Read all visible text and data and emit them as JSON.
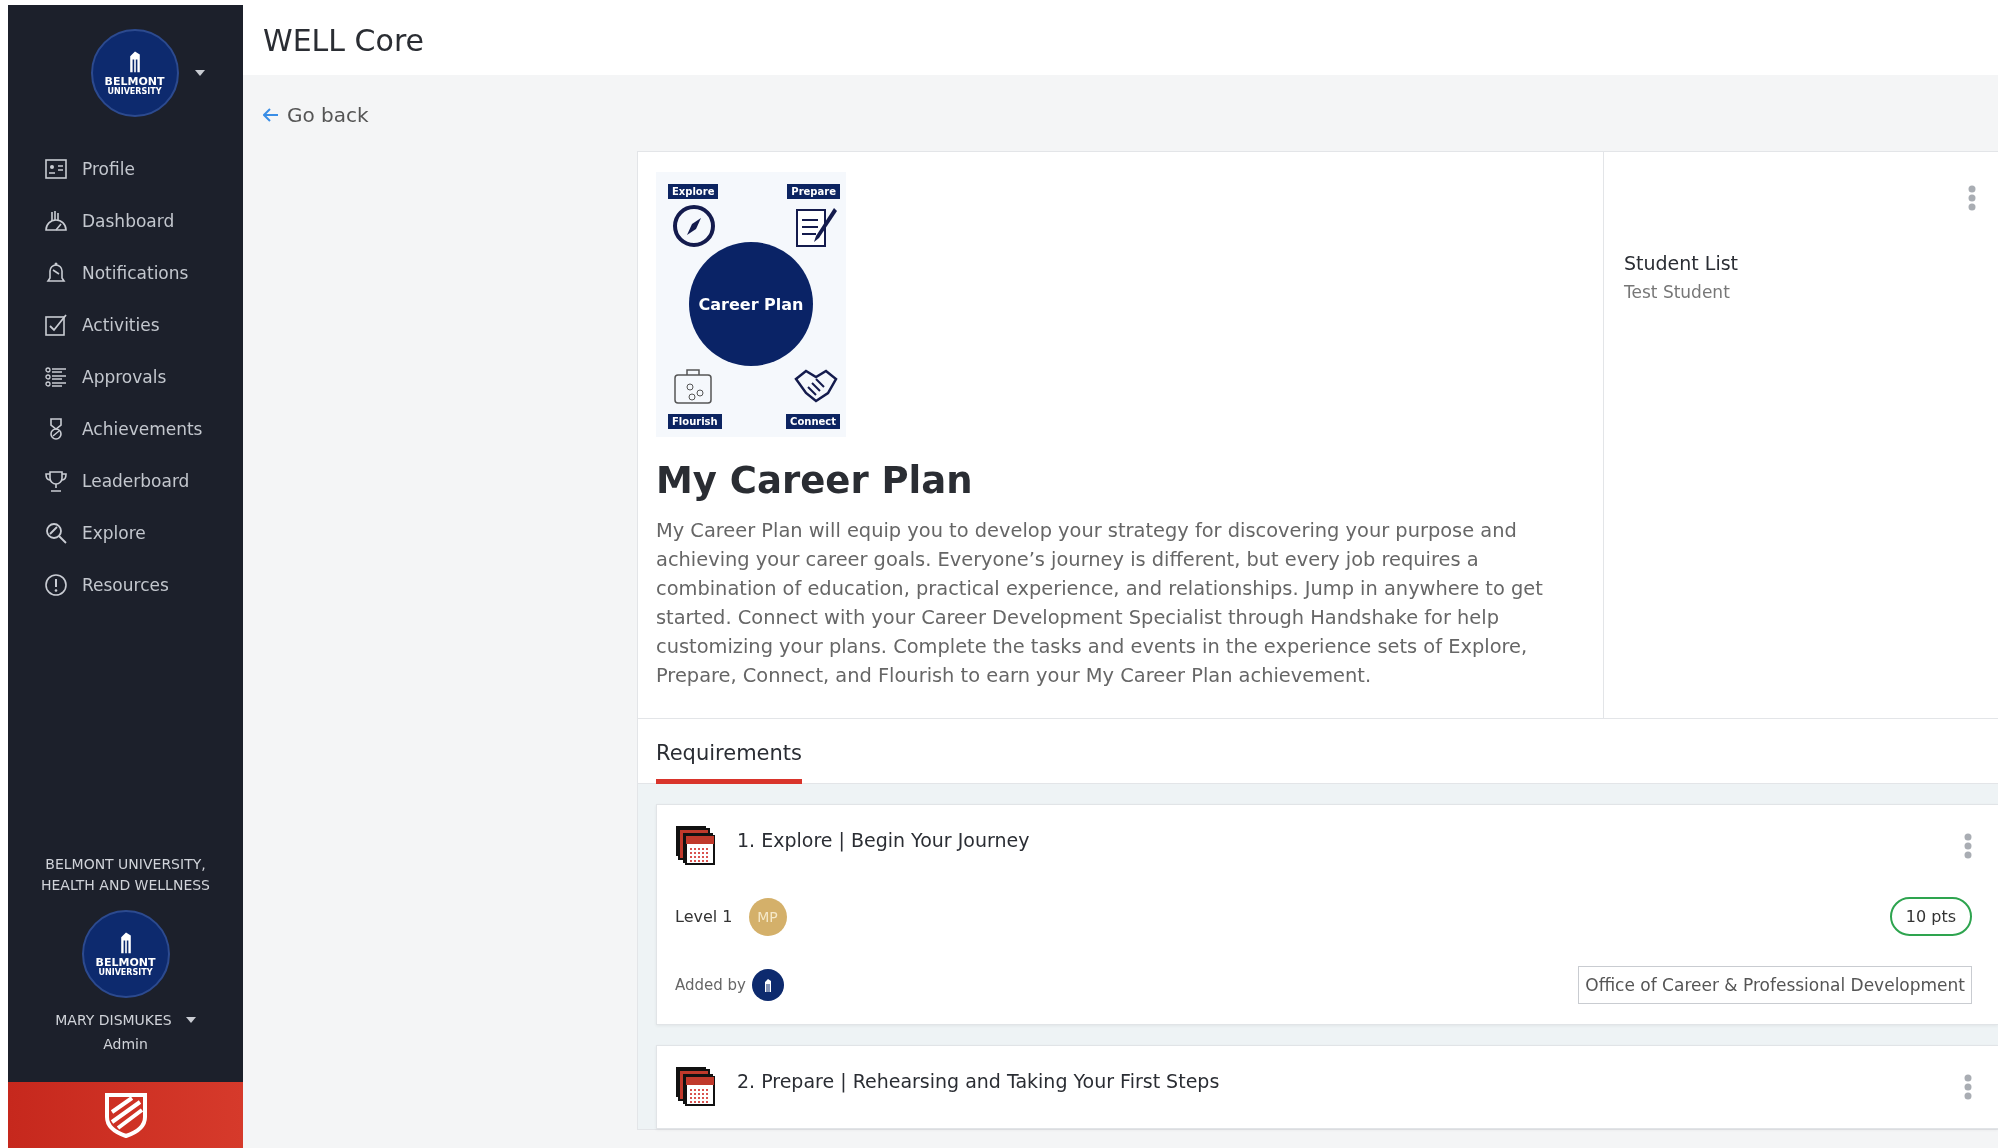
{
  "sidebar": {
    "logo": {
      "line1": "BELMONT",
      "line2": "UNIVERSITY"
    },
    "items": [
      {
        "label": "Profile",
        "selected": false
      },
      {
        "label": "Dashboard",
        "selected": false
      },
      {
        "label": "Notifications",
        "selected": false
      },
      {
        "label": "Activities",
        "selected": false
      },
      {
        "label": "Approvals",
        "selected": false
      },
      {
        "label": "Achievements",
        "selected": false
      },
      {
        "label": "Leaderboard",
        "selected": false
      },
      {
        "label": "Explore",
        "selected": false
      },
      {
        "label": "Resources",
        "selected": false
      }
    ],
    "org": "BELMONT UNIVERSITY, HEALTH AND WELLNESS",
    "user_logo": {
      "line1": "BELMONT",
      "line2": "UNIVERSITY"
    },
    "user_name": "MARY DISMUKES",
    "user_role": "Admin"
  },
  "header": {
    "title": "WELL Core"
  },
  "back_link": "Go back",
  "plan": {
    "image": {
      "center": "Career Plan",
      "labels": [
        "Explore",
        "Prepare",
        "Flourish",
        "Connect"
      ]
    },
    "title": "My Career Plan",
    "description": "My Career Plan will equip you to develop your strategy for discovering your purpose and achieving your career goals. Everyone’s journey is different, but every job requires a combination of education, practical experience, and relationships. Jump in anywhere to get started. Connect with your Career Development Specialist through Handshake for help customizing your plans. Complete the tasks and events in the experience sets of Explore, Prepare, Connect, and Flourish to earn your My Career Plan achievement.",
    "student_list": {
      "heading": "Student List",
      "students": [
        "Test Student"
      ]
    }
  },
  "tabs": [
    {
      "label": "Requirements",
      "selected": true
    }
  ],
  "requirements": [
    {
      "title": "1. Explore | Begin Your Journey",
      "level": "Level 1",
      "avatar": "MP",
      "points": "10 pts",
      "added_by": "Added by",
      "organization": "Office of Career & Professional Development"
    },
    {
      "title": "2. Prepare | Rehearsing and Taking Your First Steps"
    }
  ]
}
